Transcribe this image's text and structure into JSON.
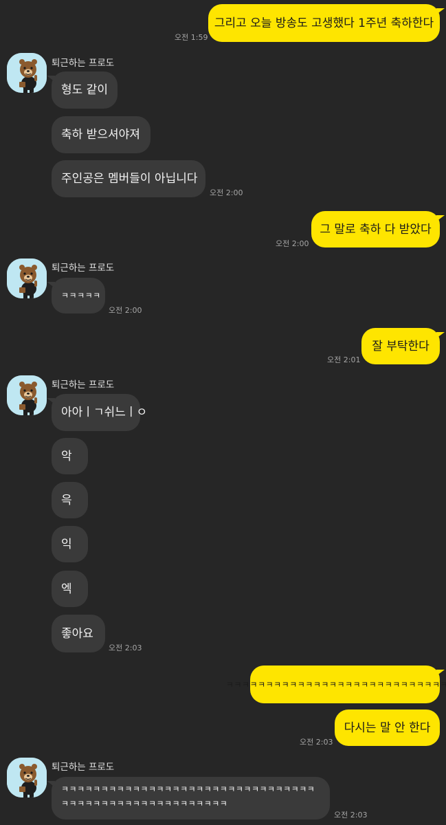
{
  "sender_name": "퇴근하는 프로도",
  "messages": {
    "m1": {
      "text": "그리고 오늘 방송도 고생했다 1주년 축하한다",
      "time": "오전 1:59"
    },
    "m2": {
      "text": "형도 같이"
    },
    "m3": {
      "text": "축하 받으셔야져"
    },
    "m4": {
      "text": "주인공은 멤버들이 아닙니다",
      "time": "오전 2:00"
    },
    "m5": {
      "text": "그 말로 축하 다 받았다",
      "time": "오전 2:00"
    },
    "m6": {
      "text": "ㅋㅋㅋㅋㅋ",
      "time": "오전 2:00"
    },
    "m7": {
      "text": "잘 부탁한다",
      "time": "오전 2:01"
    },
    "m8": {
      "text": "아아ㅣㄱ쉬느ㅣㅇ"
    },
    "m9": {
      "text": "악"
    },
    "m10": {
      "text": "윽"
    },
    "m11": {
      "text": "익"
    },
    "m12": {
      "text": "엑"
    },
    "m13": {
      "text": "좋아요",
      "time": "오전 2:03"
    },
    "m14": {
      "text": "ㅋㅋㅋㅋㅋㅋㅋㅋㅋㅋㅋㅋㅋㅋㅋㅋㅋㅋㅋㅋㅋㅋㅋㅋㅋㅋㅋㅋㅋㅋ"
    },
    "m15": {
      "text": "다시는 말 안 한다",
      "time": "오전 2:03"
    },
    "m16": {
      "text": "ㅋㅋㅋㅋㅋㅋㅋㅋㅋㅋㅋㅋㅋㅋㅋㅋㅋㅋㅋㅋㅋㅋㅋㅋㅋㅋㅋㅋㅋㅋㅋㅋㅋㅋㅋㅋㅋㅋㅋㅋㅋㅋㅋㅋㅋㅋㅋㅋㅋㅋㅋㅋㅋ",
      "time": "오전 2:03"
    }
  },
  "colors": {
    "background": "#262626",
    "outgoing_bubble": "#fee500",
    "incoming_bubble": "#3a3a3a",
    "avatar_background": "#bfe7f2"
  },
  "icons": {
    "avatar": "frodo-character-avatar-icon"
  }
}
